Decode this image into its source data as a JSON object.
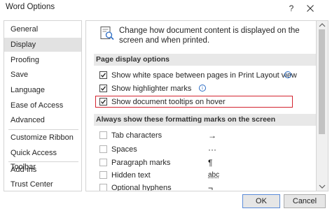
{
  "window": {
    "title": "Word Options",
    "help_label": "?"
  },
  "sidebar": {
    "items": [
      {
        "label": "General"
      },
      {
        "label": "Display",
        "selected": true
      },
      {
        "label": "Proofing"
      },
      {
        "label": "Save"
      },
      {
        "label": "Language"
      },
      {
        "label": "Ease of Access"
      },
      {
        "label": "Advanced"
      },
      {
        "label": "Customize Ribbon"
      },
      {
        "label": "Quick Access Toolbar"
      },
      {
        "label": "Add-ins"
      },
      {
        "label": "Trust Center"
      }
    ]
  },
  "intro": {
    "text": "Change how document content is displayed on the screen and when printed.",
    "icon": "document-magnifier-icon"
  },
  "page_display": {
    "header": "Page display options",
    "options": [
      {
        "label": "Show white space between pages in Print Layout view",
        "checked": true,
        "info": true
      },
      {
        "label": "Show highlighter marks",
        "checked": true,
        "info": true
      },
      {
        "label": "Show document tooltips on hover",
        "checked": true,
        "info": false,
        "highlighted": true
      }
    ]
  },
  "formatting_marks": {
    "header": "Always show these formatting marks on the screen",
    "options": [
      {
        "label": "Tab characters",
        "checked": false,
        "mark": "→"
      },
      {
        "label": "Spaces",
        "checked": false,
        "mark": "···"
      },
      {
        "label": "Paragraph marks",
        "checked": false,
        "mark": "¶"
      },
      {
        "label": "Hidden text",
        "checked": false,
        "mark": "abc"
      },
      {
        "label": "Optional hyphens",
        "checked": false,
        "mark": "¬"
      }
    ]
  },
  "buttons": {
    "ok": "OK",
    "cancel": "Cancel"
  },
  "colors": {
    "highlight_border": "#d3242f",
    "selected_item_bg": "#e2e2e2",
    "info_icon": "#2b6cc4"
  }
}
